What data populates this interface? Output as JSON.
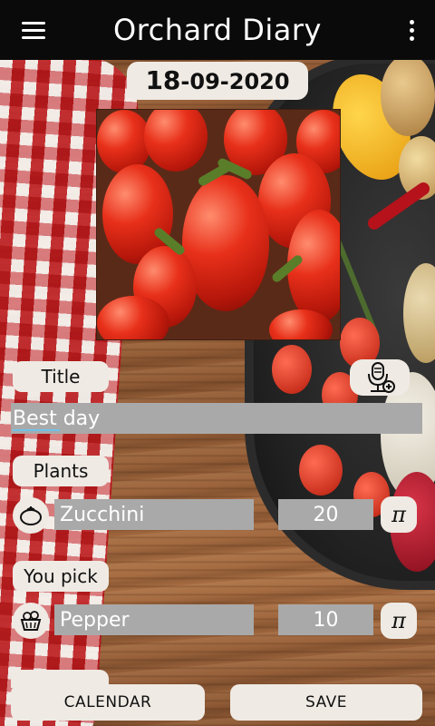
{
  "app": {
    "title": "Orchard Diary"
  },
  "date": {
    "day": "18",
    "rest": "-09-2020"
  },
  "title_section": {
    "label": "Title",
    "value": "Best day"
  },
  "plants_section": {
    "label": "Plants",
    "item_name": "Zucchini",
    "item_quantity": "20",
    "icon": "vegetable-icon"
  },
  "you_pick_section": {
    "label": "You pick",
    "item_name": "Pepper",
    "item_quantity": "10",
    "icon": "basket-icon"
  },
  "buttons": {
    "calendar": "CALENDAR",
    "save": "SAVE",
    "pi_symbol": "π"
  },
  "colors": {
    "appbar": "#0a0a0a",
    "pill": "#efeae4",
    "field": "#a9a9a9"
  }
}
